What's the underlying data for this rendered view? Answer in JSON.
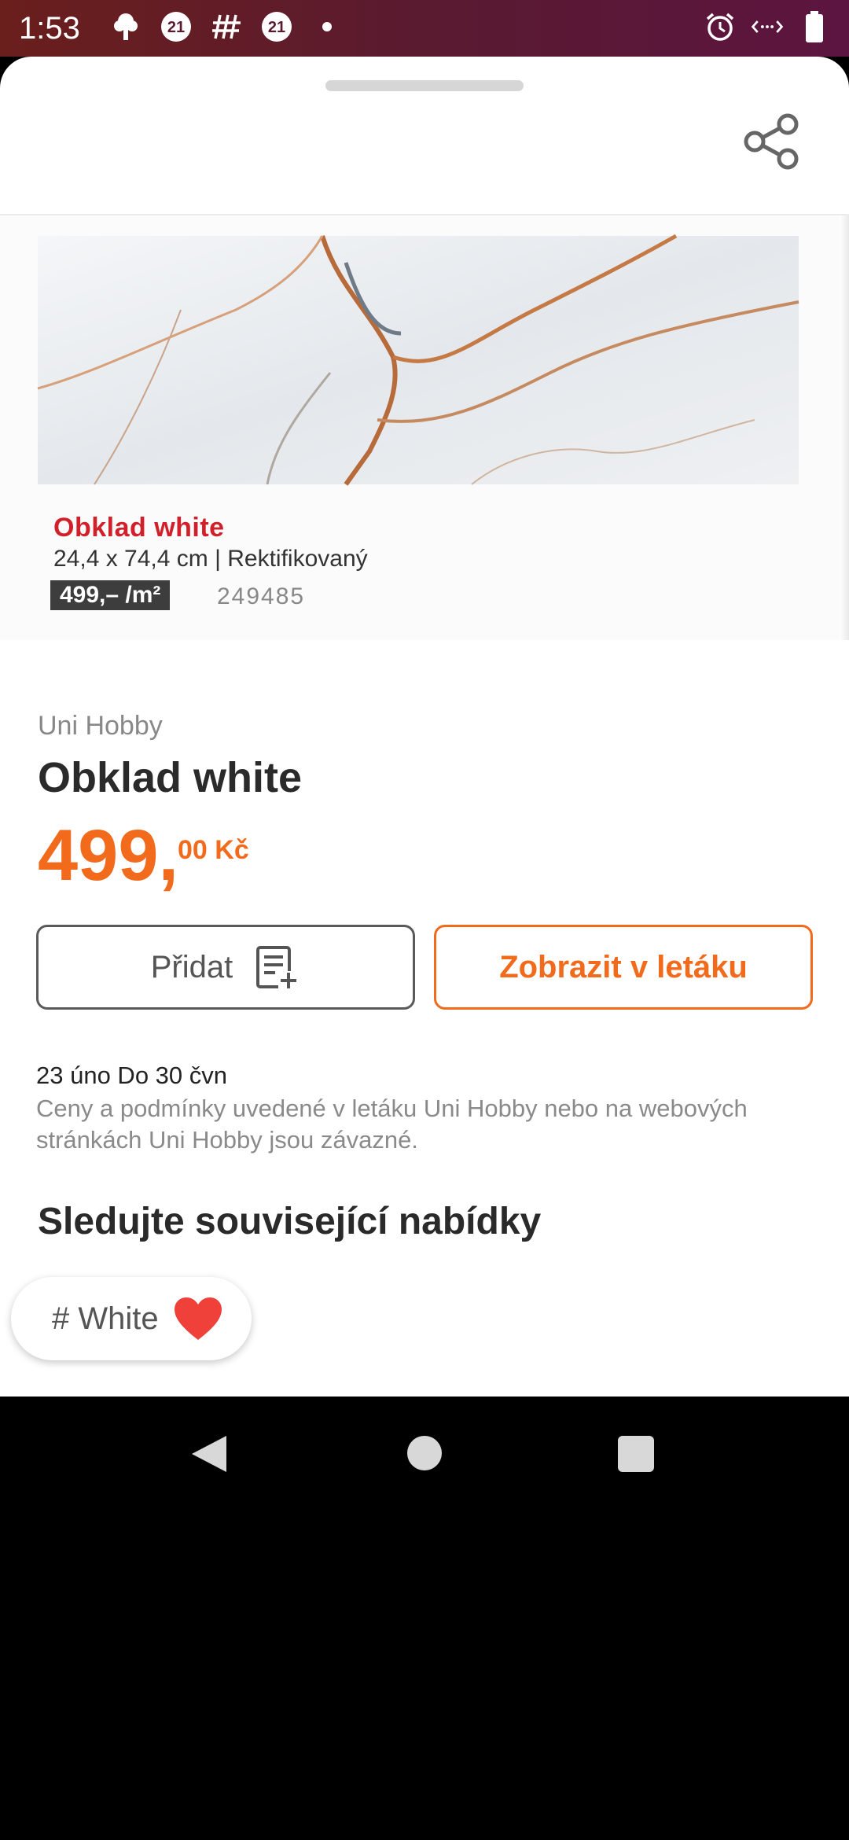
{
  "status_bar": {
    "time": "1:53",
    "left_icons": [
      "tree-icon",
      "badge-21-icon",
      "hashtag-icon",
      "badge-21-icon",
      "dot-icon"
    ],
    "right_icons": [
      "alarm-icon",
      "data-icon",
      "battery-icon"
    ]
  },
  "product_image": {
    "caption_title": "Obklad white",
    "caption_dims": "24,4 x 74,4 cm | Rektifikovaný",
    "caption_price": "499,– /m²",
    "caption_code": "249485"
  },
  "product": {
    "store": "Uni Hobby",
    "title": "Obklad white",
    "price_main": "499,",
    "price_sup": "00 Kč"
  },
  "actions": {
    "add_label": "Přidat",
    "flyer_label": "Zobrazit v letáku"
  },
  "validity": {
    "dates": "23 úno Do 30 čvn",
    "terms": "Ceny a podmínky uvedené v letáku Uni Hobby nebo na webových stránkách Uni Hobby jsou závazné."
  },
  "related": {
    "heading": "Sledujte související nabídky",
    "chip_label": "# White"
  },
  "colors": {
    "accent": "#f26a1b",
    "status_bar": "#5e1a2e",
    "heart": "#f0403a"
  }
}
